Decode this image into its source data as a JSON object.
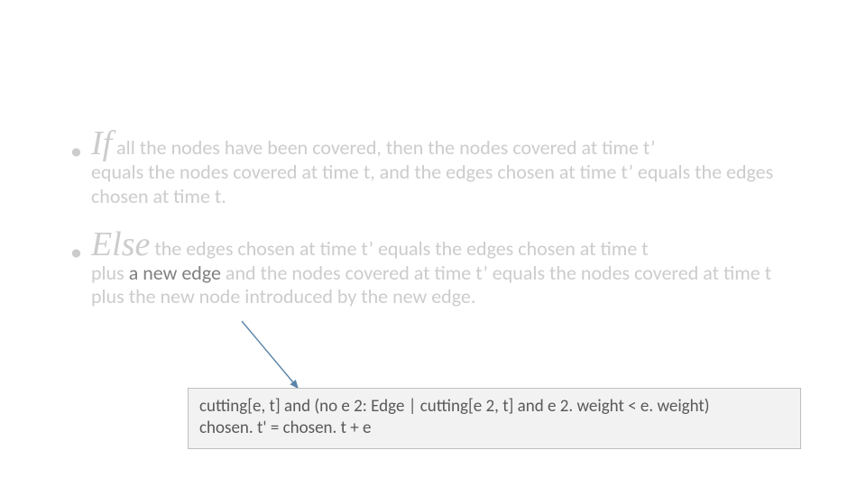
{
  "bullets": {
    "if": {
      "keyword": "If",
      "text_after_kw": " all the nodes have been covered, then the nodes covered at time t’",
      "continuation": "equals the nodes covered at time t, and the edges chosen at time t’ equals the edges chosen at time t."
    },
    "else": {
      "keyword": "Else",
      "text_after_kw": " the edges chosen at time t’ equals the edges chosen at time t",
      "cont_prefix": "plus ",
      "cont_highlight": "a new edge",
      "cont_suffix": " and the nodes covered at time t’ equals the nodes covered at time t plus the new node introduced by the new edge."
    }
  },
  "callout": {
    "line1": "cutting[e, t] and (no e 2: Edge | cutting[e 2, t] and e 2. weight < e. weight)",
    "line2": "chosen. t' = chosen. t + e"
  },
  "colors": {
    "light": "#cccccc",
    "mid": "#808080",
    "box_bg": "#f2f2f2",
    "box_border": "#bfbfbf",
    "arrow": "#5a84a8"
  }
}
